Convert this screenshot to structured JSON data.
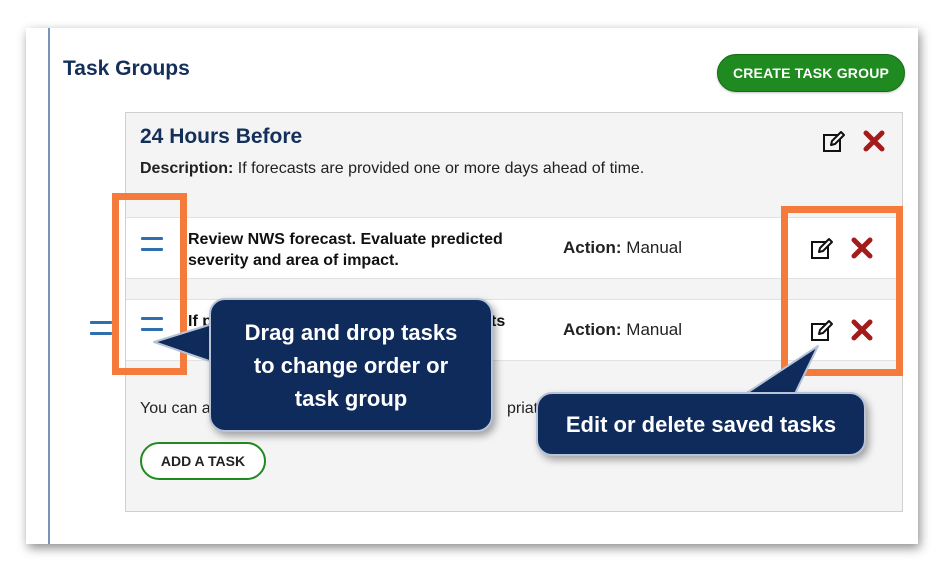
{
  "page": {
    "title": "Task Groups",
    "create_button": "CREATE TASK GROUP"
  },
  "task_group": {
    "title": "24 Hours Before",
    "description_label": "Description:",
    "description_text": "If forecasts are provided one or more days ahead of time.",
    "edit_icon": "edit-icon",
    "delete_icon": "delete-x-icon"
  },
  "tasks": [
    {
      "text": "Review NWS forecast. Evaluate predicted severity and area of impact.",
      "action_label": "Action:",
      "action_value": "Manual"
    },
    {
      "text": "If p",
      "text_tail": "ts",
      "action_label": "Action:",
      "action_value": "Manual"
    }
  ],
  "helper": {
    "text_start": "You can a",
    "text_end": "priate."
  },
  "add_task_button": "ADD A TASK",
  "callouts": {
    "drag": "Drag and drop tasks to change order or task group",
    "edit": "Edit or delete saved tasks"
  },
  "colors": {
    "accent_green": "#1f8a1f",
    "heading_navy": "#14305a",
    "highlight_orange": "#f57b3c",
    "callout_navy": "#0f2b5b",
    "delete_red": "#a31b1b",
    "handle_blue": "#2f6fb0"
  }
}
